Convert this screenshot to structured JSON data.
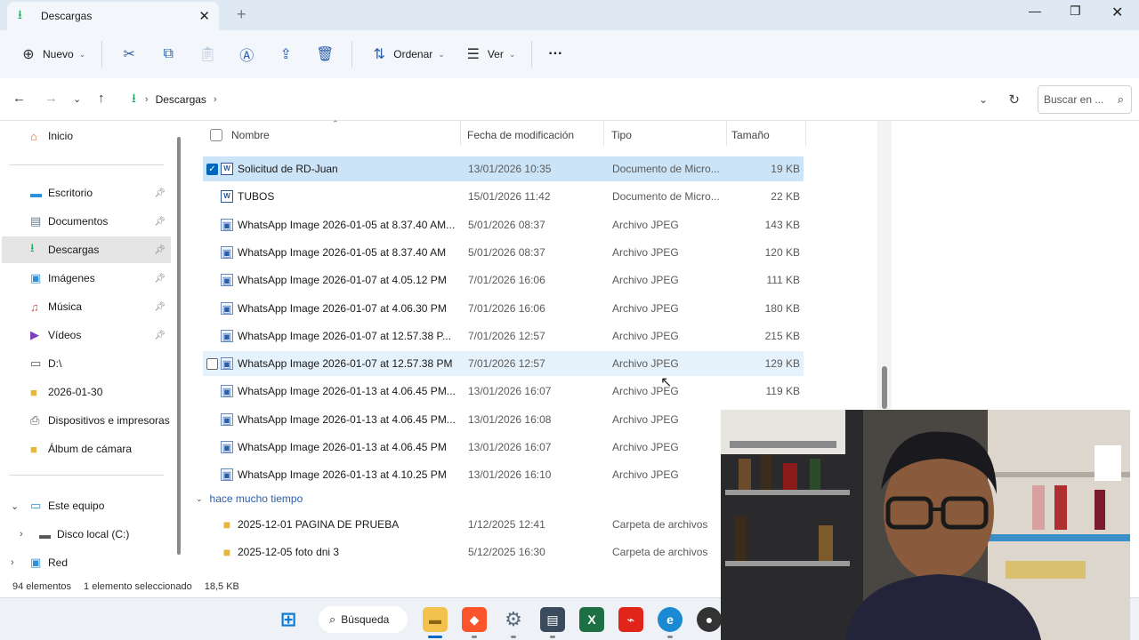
{
  "window": {
    "tab_title": "Descargas",
    "new_tab": "+"
  },
  "toolbar": {
    "new_label": "Nuevo",
    "sort_label": "Ordenar",
    "view_label": "Ver",
    "more_label": "···"
  },
  "address": {
    "crumb": "Descargas",
    "search_placeholder": "Buscar en ..."
  },
  "sidebar": {
    "items": [
      {
        "label": "Inicio",
        "icon": "home-icon"
      },
      {
        "label": "Escritorio",
        "icon": "desktop-icon",
        "pinned": true
      },
      {
        "label": "Documentos",
        "icon": "documents-icon",
        "pinned": true
      },
      {
        "label": "Descargas",
        "icon": "downloads-icon",
        "pinned": true,
        "selected": true
      },
      {
        "label": "Imágenes",
        "icon": "pictures-icon",
        "pinned": true
      },
      {
        "label": "Música",
        "icon": "music-icon",
        "pinned": true
      },
      {
        "label": "Vídeos",
        "icon": "videos-icon",
        "pinned": true
      },
      {
        "label": "D:\\",
        "icon": "drive-icon"
      },
      {
        "label": "2026-01-30",
        "icon": "folder-icon"
      },
      {
        "label": "Dispositivos e impresoras",
        "icon": "printer-icon"
      },
      {
        "label": "Álbum de cámara",
        "icon": "folder-icon"
      },
      {
        "label": "Este equipo",
        "icon": "computer-icon"
      },
      {
        "label": "Disco local (C:)",
        "icon": "disk-icon"
      },
      {
        "label": "Red",
        "icon": "network-icon"
      }
    ]
  },
  "columns": {
    "name": "Nombre",
    "date": "Fecha de modificación",
    "type": "Tipo",
    "size": "Tamaño"
  },
  "files": [
    {
      "name": "Solicitud de RD-Juan",
      "date": "13/01/2026 10:35",
      "type": "Documento de Micro...",
      "size": "19 KB",
      "kind": "doc",
      "selected": true
    },
    {
      "name": "TUBOS",
      "date": "15/01/2026 11:42",
      "type": "Documento de Micro...",
      "size": "22 KB",
      "kind": "doc"
    },
    {
      "name": "WhatsApp Image 2026-01-05 at 8.37.40 AM...",
      "date": "5/01/2026 08:37",
      "type": "Archivo JPEG",
      "size": "143 KB",
      "kind": "img"
    },
    {
      "name": "WhatsApp Image 2026-01-05 at 8.37.40 AM",
      "date": "5/01/2026 08:37",
      "type": "Archivo JPEG",
      "size": "120 KB",
      "kind": "img"
    },
    {
      "name": "WhatsApp Image 2026-01-07 at 4.05.12 PM",
      "date": "7/01/2026 16:06",
      "type": "Archivo JPEG",
      "size": "111 KB",
      "kind": "img"
    },
    {
      "name": "WhatsApp Image 2026-01-07 at 4.06.30 PM",
      "date": "7/01/2026 16:06",
      "type": "Archivo JPEG",
      "size": "180 KB",
      "kind": "img"
    },
    {
      "name": "WhatsApp Image 2026-01-07 at 12.57.38 P...",
      "date": "7/01/2026 12:57",
      "type": "Archivo JPEG",
      "size": "215 KB",
      "kind": "img"
    },
    {
      "name": "WhatsApp Image 2026-01-07 at 12.57.38 PM",
      "date": "7/01/2026 12:57",
      "type": "Archivo JPEG",
      "size": "129 KB",
      "kind": "img",
      "hover": true
    },
    {
      "name": "WhatsApp Image 2026-01-13 at 4.06.45 PM...",
      "date": "13/01/2026 16:07",
      "type": "Archivo JPEG",
      "size": "119 KB",
      "kind": "img"
    },
    {
      "name": "WhatsApp Image 2026-01-13 at 4.06.45 PM...",
      "date": "13/01/2026 16:08",
      "type": "Archivo JPEG",
      "size": "",
      "kind": "img"
    },
    {
      "name": "WhatsApp Image 2026-01-13 at 4.06.45 PM",
      "date": "13/01/2026 16:07",
      "type": "Archivo JPEG",
      "size": "",
      "kind": "img"
    },
    {
      "name": "WhatsApp Image 2026-01-13 at 4.10.25 PM",
      "date": "13/01/2026 16:10",
      "type": "Archivo JPEG",
      "size": "",
      "kind": "img"
    }
  ],
  "group": {
    "label": "hace mucho tiempo"
  },
  "old_files": [
    {
      "name": "2025-12-01 PAGINA DE PRUEBA",
      "date": "1/12/2025 12:41",
      "type": "Carpeta de archivos",
      "size": "",
      "kind": "folder"
    },
    {
      "name": "2025-12-05 foto dni 3",
      "date": "5/12/2025 16:30",
      "type": "Carpeta de archivos",
      "size": "",
      "kind": "folder"
    }
  ],
  "status": {
    "count": "94 elementos",
    "selection": "1 elemento seleccionado",
    "size": "18,5 KB"
  },
  "taskbar": {
    "search_label": "Búsqueda"
  },
  "colors": {
    "accent": "#0067c0",
    "selection": "#cce4f7",
    "downloads_green": "#18a558",
    "folder_yellow": "#e8b53b"
  }
}
